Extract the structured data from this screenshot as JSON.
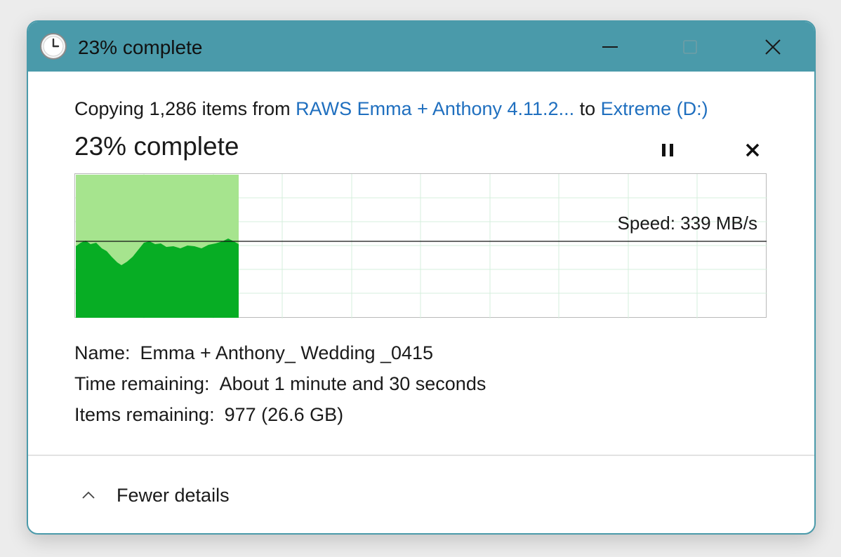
{
  "window": {
    "title": "23% complete",
    "controls": {
      "minimize": "minimize-icon",
      "maximize": "maximize-icon",
      "close": "close-icon"
    }
  },
  "copy": {
    "prefix": "Copying 1,286 items from ",
    "source": "RAWS Emma + Anthony 4.11.2...",
    "connector": " to ",
    "destination": "Extreme (D:)"
  },
  "progress": {
    "label": "23% complete",
    "percent": 23,
    "speed_label": "Speed: 339 MB/s"
  },
  "details": {
    "name_key": "Name:",
    "name_value": "Emma + Anthony_ Wedding _0415",
    "time_key": "Time remaining:",
    "time_value": "About 1 minute and 30 seconds",
    "items_key": "Items remaining:",
    "items_value": "977 (26.6 GB)"
  },
  "footer": {
    "toggle_label": "Fewer details"
  },
  "colors": {
    "titlebar": "#4a9aaa",
    "link": "#1f6fbf",
    "progress_fill_light": "#a6e48e",
    "speed_fill": "#07ad24",
    "grid": "#d4efdc"
  }
}
